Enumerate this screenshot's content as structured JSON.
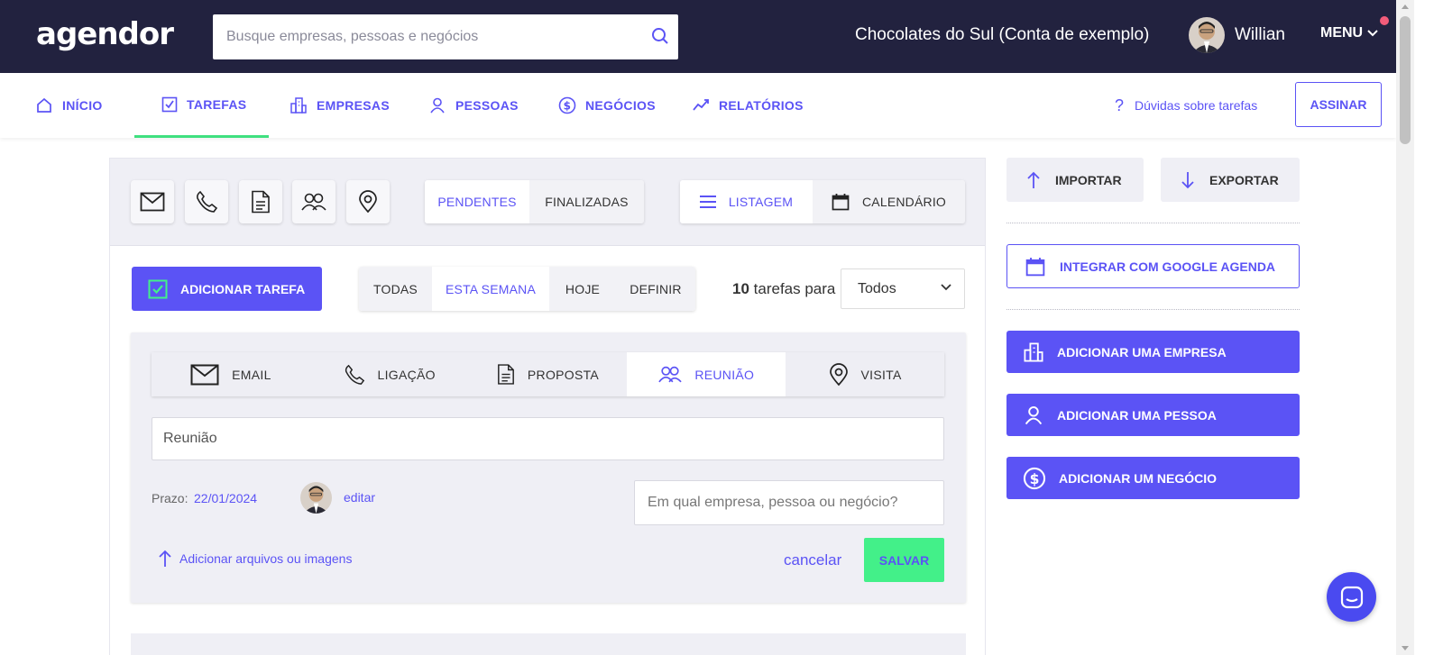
{
  "brand": {
    "logo": "agendor",
    "accent": "#5b53f5",
    "dark": "#22223f",
    "success": "#43f089"
  },
  "header": {
    "search_placeholder": "Busque empresas, pessoas e negócios",
    "account": "Chocolates do Sul (Conta de exemplo)",
    "user": "Willian",
    "menu_label": "MENU"
  },
  "nav": {
    "items": [
      {
        "label": "INÍCIO",
        "icon": "home-icon"
      },
      {
        "label": "TAREFAS",
        "icon": "checkbox-icon",
        "active": true
      },
      {
        "label": "EMPRESAS",
        "icon": "building-icon"
      },
      {
        "label": "PESSOAS",
        "icon": "person-icon"
      },
      {
        "label": "NEGÓCIOS",
        "icon": "dollar-icon"
      },
      {
        "label": "RELATÓRIOS",
        "icon": "chart-line-icon"
      }
    ],
    "help": "Dúvidas sobre tarefas",
    "subscribe": "ASSINAR"
  },
  "tasks": {
    "status_tabs": [
      "PENDENTES",
      "FINALIZADAS"
    ],
    "status_selected": "PENDENTES",
    "view_tabs": [
      "LISTAGEM",
      "CALENDÁRIO"
    ],
    "view_selected": "LISTAGEM",
    "add_task": "ADICIONAR TAREFA",
    "period_tabs": [
      "TODAS",
      "ESTA SEMANA",
      "HOJE",
      "DEFINIR"
    ],
    "period_selected": "ESTA SEMANA",
    "count": "10",
    "count_suffix": "tarefas para",
    "assignee": "Todos"
  },
  "form": {
    "types": [
      "EMAIL",
      "LIGAÇÃO",
      "PROPOSTA",
      "REUNIÃO",
      "VISITA"
    ],
    "type_selected": "REUNIÃO",
    "title_value": "Reunião",
    "deadline_label": "Prazo:",
    "deadline_value": "22/01/2024",
    "edit": "editar",
    "related_placeholder": "Em qual empresa, pessoa ou negócio?",
    "attach": "Adicionar arquivos ou imagens",
    "cancel": "cancelar",
    "save": "SALVAR"
  },
  "sidebar": {
    "import": "IMPORTAR",
    "export": "EXPORTAR",
    "google": "INTEGRAR COM GOOGLE AGENDA",
    "add_company": "ADICIONAR UMA EMPRESA",
    "add_person": "ADICIONAR UMA PESSOA",
    "add_deal": "ADICIONAR UM NEGÓCIO"
  }
}
